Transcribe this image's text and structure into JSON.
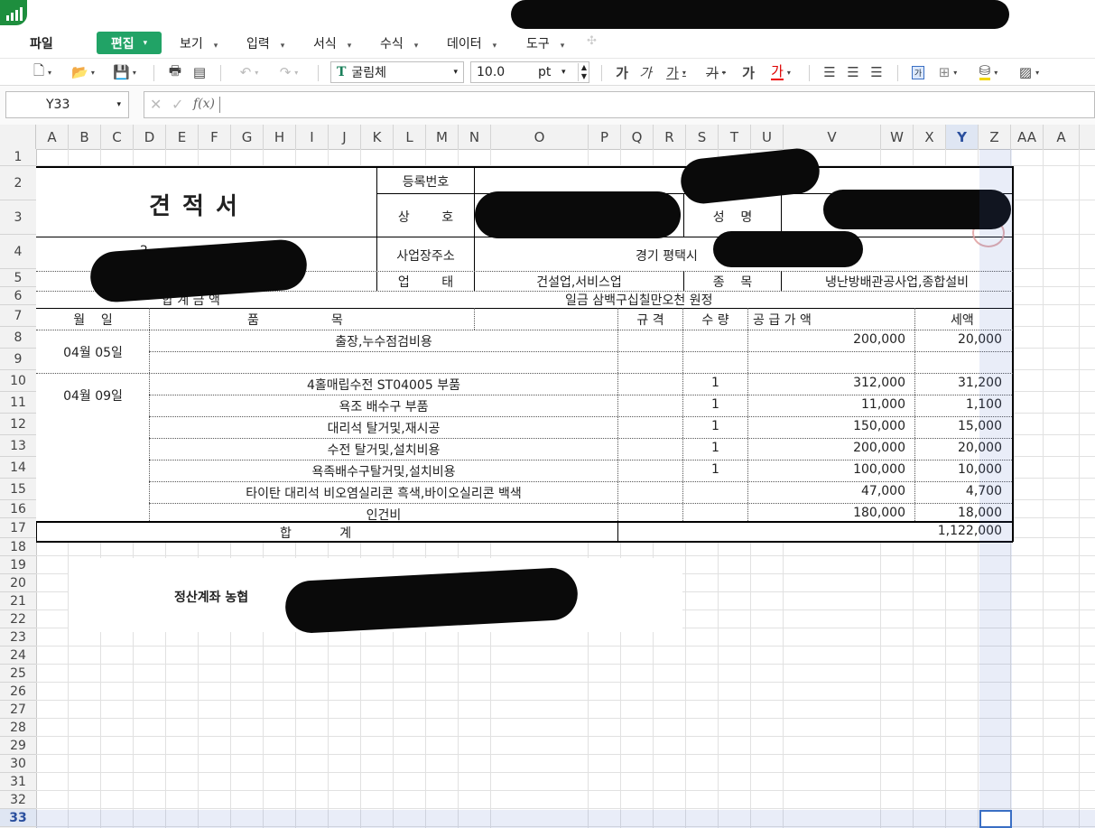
{
  "menu": {
    "file": "파일",
    "edit": "편집",
    "view": "보기",
    "insert": "입력",
    "format": "서식",
    "formula": "수식",
    "data": "데이터",
    "tools": "도구"
  },
  "toolbar": {
    "font_name": "굴림체",
    "font_size": "10.0",
    "font_unit": "pt",
    "bold_glyph": "가",
    "italic_glyph": "가",
    "underline_glyph": "가",
    "strike_glyph": "가",
    "shadow_glyph": "가",
    "color_glyph": "가",
    "cellstyle_glyph": "가"
  },
  "formula_bar": {
    "cell_ref": "Y33",
    "fx": "f(x)",
    "content": ""
  },
  "columns": [
    "A",
    "B",
    "C",
    "D",
    "E",
    "F",
    "G",
    "H",
    "I",
    "J",
    "K",
    "L",
    "M",
    "N",
    "O",
    "P",
    "Q",
    "R",
    "S",
    "T",
    "U",
    "V",
    "W",
    "X",
    "Y",
    "Z",
    "AA",
    "A"
  ],
  "rows": [
    "1",
    "2",
    "3",
    "4",
    "5",
    "6",
    "7",
    "8",
    "9",
    "10",
    "11",
    "12",
    "13",
    "14",
    "15",
    "16",
    "17",
    "18",
    "19",
    "20",
    "21",
    "22",
    "23",
    "24",
    "25",
    "26",
    "27",
    "28",
    "29",
    "30",
    "31",
    "32",
    "33"
  ],
  "sheet": {
    "title": "견 적 서",
    "reg_no_label": "등록번호",
    "company_label": "상        호",
    "name_label": "성    명",
    "address_label": "사업장주소",
    "address_value": "경기 평택시",
    "business_type_label": "업        태",
    "business_type_value": "건설업,서비스업",
    "item_label": "종    목",
    "item_value": "냉난방배관공사업,종합설비",
    "date_prefix": "2",
    "total_amount_label": "합 계 금 액",
    "total_amount_value": "일금 삼백구십칠만오천 원정",
    "hdr_date": "월    일",
    "hdr_item": "품                  목",
    "hdr_spec": "규 격",
    "hdr_qty": "수 량",
    "hdr_supply": "공 급 가 액",
    "hdr_tax": "세액",
    "lines": [
      {
        "date": "04월 05일",
        "item": "출장,누수점검비용",
        "qty": "",
        "supply": "200,000",
        "tax": "20,000"
      },
      {
        "date": "",
        "item": "",
        "qty": "",
        "supply": "",
        "tax": ""
      },
      {
        "date": "04월 09일",
        "item": "4홀매립수전 ST04005 부품",
        "qty": "1",
        "supply": "312,000",
        "tax": "31,200"
      },
      {
        "date": "",
        "item": "욕조 배수구 부품",
        "qty": "1",
        "supply": "11,000",
        "tax": "1,100"
      },
      {
        "date": "",
        "item": "대리석 탈거및,재시공",
        "qty": "1",
        "supply": "150,000",
        "tax": "15,000"
      },
      {
        "date": "",
        "item": "수전 탈거및,설치비용",
        "qty": "1",
        "supply": "200,000",
        "tax": "20,000"
      },
      {
        "date": "",
        "item": "욕족배수구탈거및,설치비용",
        "qty": "1",
        "supply": "100,000",
        "tax": "10,000"
      },
      {
        "date": "",
        "item": "타이탄 대리석 비오염실리콘 흑색,바이오실리콘 백색",
        "qty": "",
        "supply": "47,000",
        "tax": "4,700"
      },
      {
        "date": "",
        "item": "인건비",
        "qty": "",
        "supply": "180,000",
        "tax": "18,000"
      }
    ],
    "sum_label": "합            계",
    "sum_value": "1,122,000",
    "account_label": "정산계좌 농협"
  }
}
